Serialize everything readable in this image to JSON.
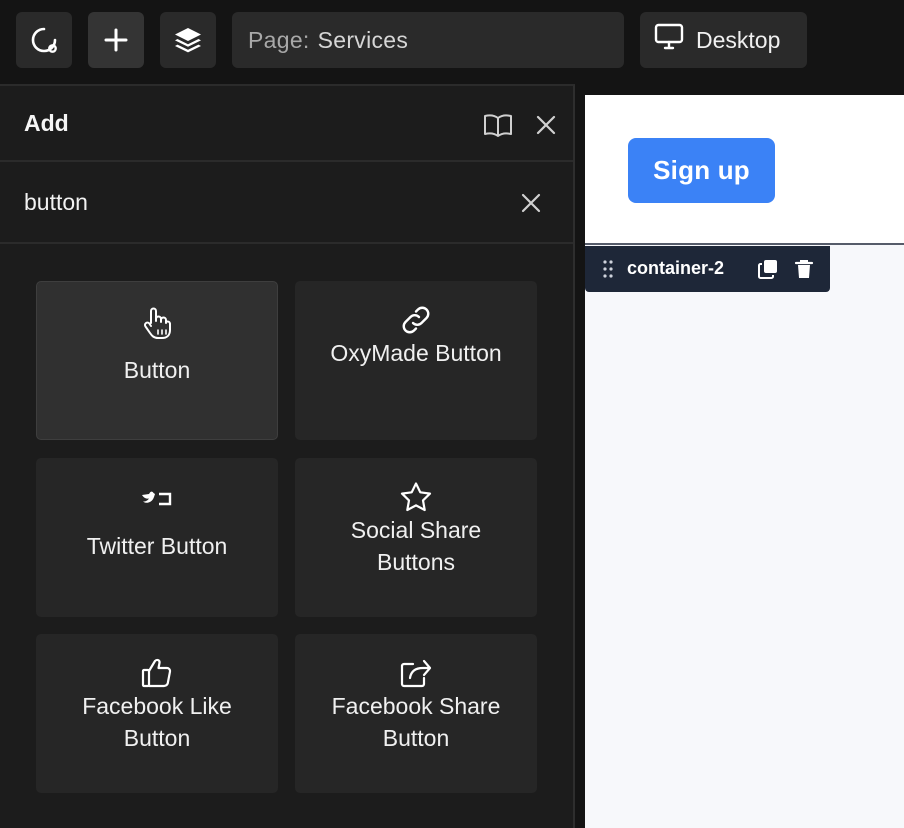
{
  "toolbar": {
    "logo_icon": "oxygen-logo-icon",
    "add_icon": "plus-icon",
    "layers_icon": "layers-icon",
    "page_prefix": "Page:",
    "page_name": "Services",
    "device_icon": "monitor-icon",
    "device_label": "Desktop"
  },
  "panel": {
    "title": "Add",
    "docs_icon": "book-icon",
    "close_icon": "close-icon",
    "search": {
      "value": "button",
      "placeholder": "",
      "clear_icon": "close-icon"
    },
    "cards": [
      {
        "label": "Button",
        "icon": "pointer-hand-icon"
      },
      {
        "label": "OxyMade Button",
        "icon": "link-icon"
      },
      {
        "label": "Twitter Button",
        "icon": "twitter-button-icon"
      },
      {
        "label": "Social Share Buttons",
        "icon": "star-icon"
      },
      {
        "label": "Facebook Like Button",
        "icon": "thumbs-up-icon"
      },
      {
        "label": "Facebook Share Button",
        "icon": "share-icon"
      }
    ]
  },
  "canvas": {
    "button_label": "Sign up",
    "selected_element": "container-2",
    "duplicate_icon": "duplicate-icon",
    "delete_icon": "trash-icon"
  },
  "colors": {
    "background": "#141414",
    "panel": "#1c1c1c",
    "card": "#262626",
    "accent": "#3b82f6",
    "selection_label": "#1e2738"
  }
}
